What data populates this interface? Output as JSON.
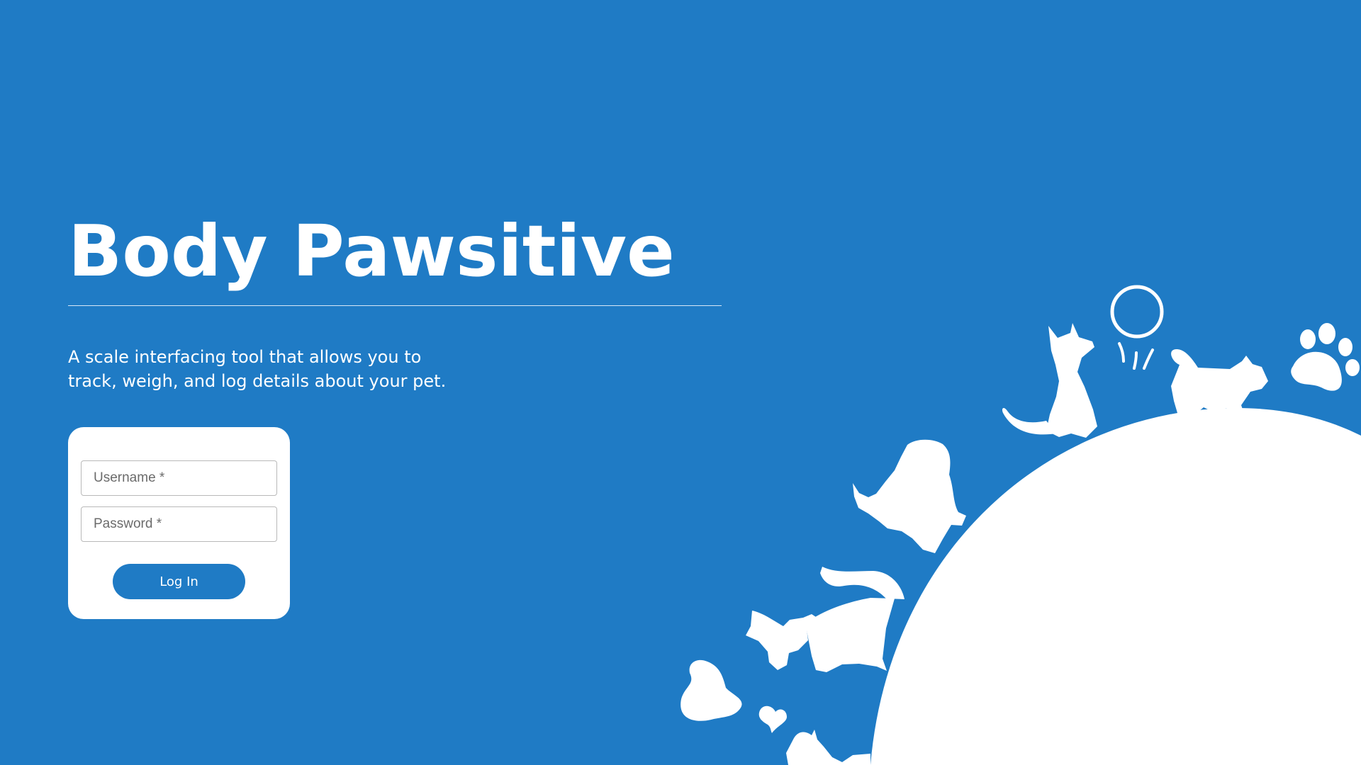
{
  "app": {
    "title": "Body Pawsitive",
    "subtitle": "A scale interfacing tool that allows you to track, weigh, and log details about your pet."
  },
  "login": {
    "username_placeholder": "Username *",
    "password_placeholder": "Password *",
    "button_label": "Log In"
  },
  "colors": {
    "background": "#1f7bc5",
    "button": "#1f7bc5",
    "card": "#ffffff",
    "text_light": "#ffffff"
  },
  "icons": {
    "illustration": "pets-on-planet-illustration",
    "ball": "ball-icon",
    "paw": "paw-print-icon",
    "hearts": "heart-icon"
  }
}
